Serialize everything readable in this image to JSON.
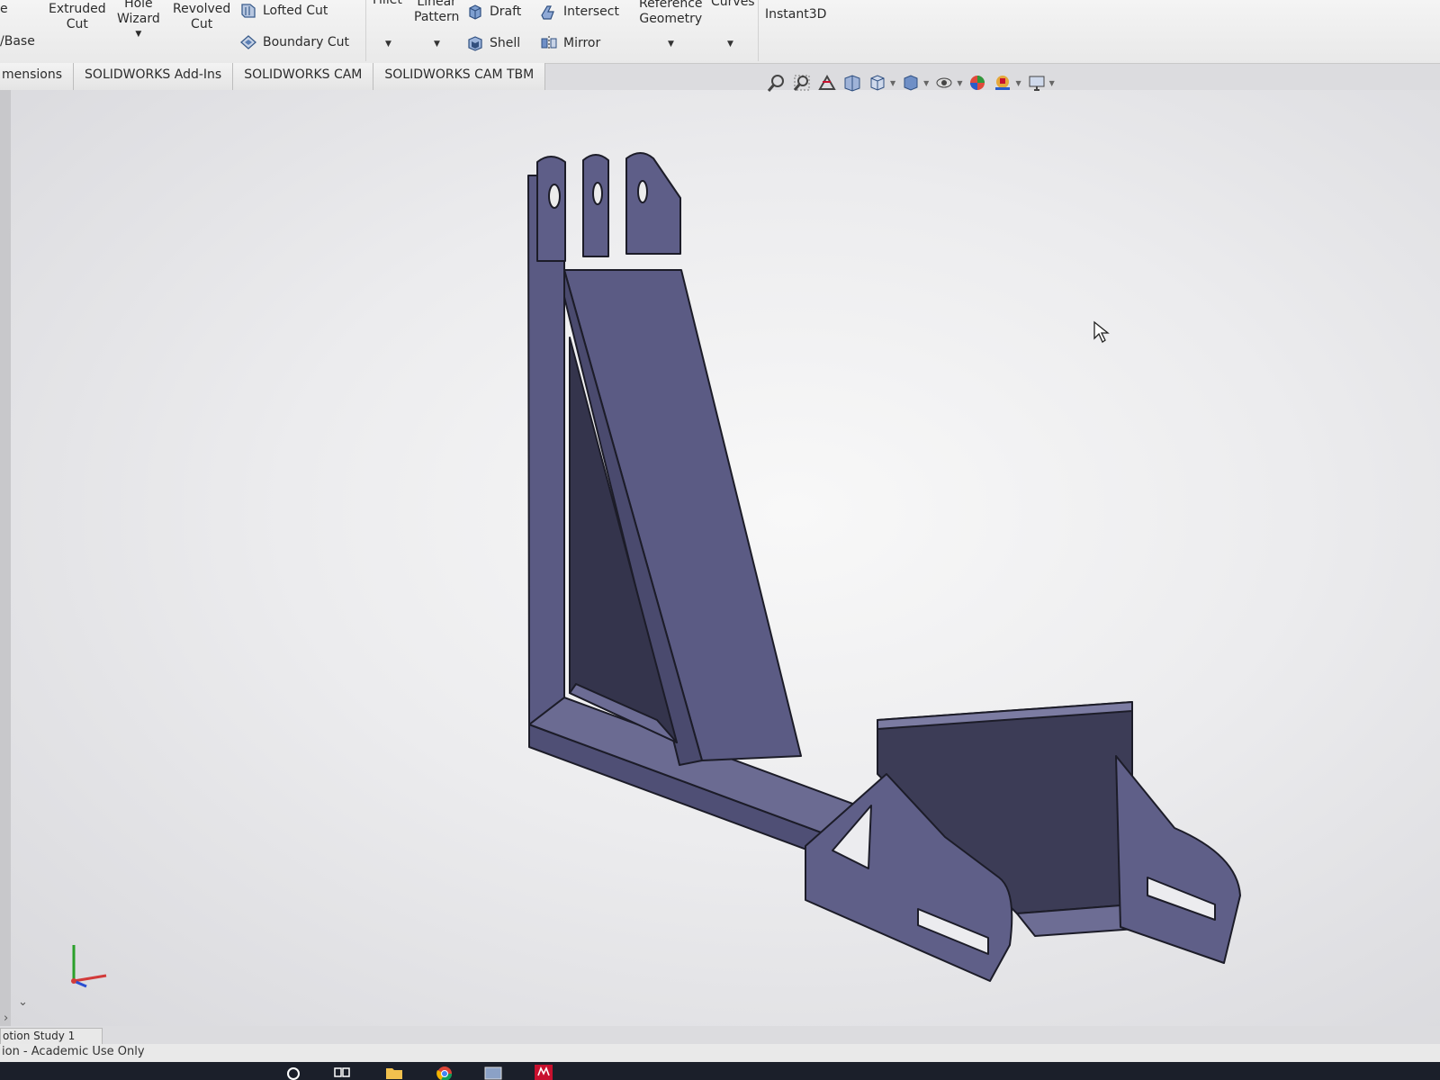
{
  "ribbon": {
    "base_label": "/Base",
    "cut_top_label": "e",
    "extruded_cut": "Extruded\nCut",
    "hole_wizard": "Hole\nWizard",
    "revolved_cut": "Revolved\nCut",
    "lofted_cut": "Lofted Cut",
    "boundary_cut": "Boundary Cut",
    "fillet": "Fillet",
    "linear_pattern": "Linear\nPattern",
    "draft": "Draft",
    "shell": "Shell",
    "intersect": "Intersect",
    "mirror": "Mirror",
    "reference_geometry": "Reference\nGeometry",
    "curves": "Curves",
    "instant3d": "Instant3D"
  },
  "tabs": [
    {
      "label": "mensions"
    },
    {
      "label": "SOLIDWORKS Add-Ins"
    },
    {
      "label": "SOLIDWORKS CAM"
    },
    {
      "label": "SOLIDWORKS CAM TBM"
    }
  ],
  "view_toolbar": {
    "icons": [
      "zoom-to-fit-icon",
      "zoom-area-icon",
      "previous-view-icon",
      "section-view-icon",
      "view-orientation-icon",
      "display-style-icon",
      "hide-show-icon",
      "appearance-icon",
      "scene-icon",
      "view-settings-icon"
    ]
  },
  "status": {
    "motion_study_tab": "otion Study 1",
    "edition": "ion - Academic Use Only"
  },
  "colors": {
    "model_face": "#5f5f86",
    "model_dark": "#3b3b55",
    "model_light": "#6d6d94",
    "accent": "#c8102e"
  }
}
